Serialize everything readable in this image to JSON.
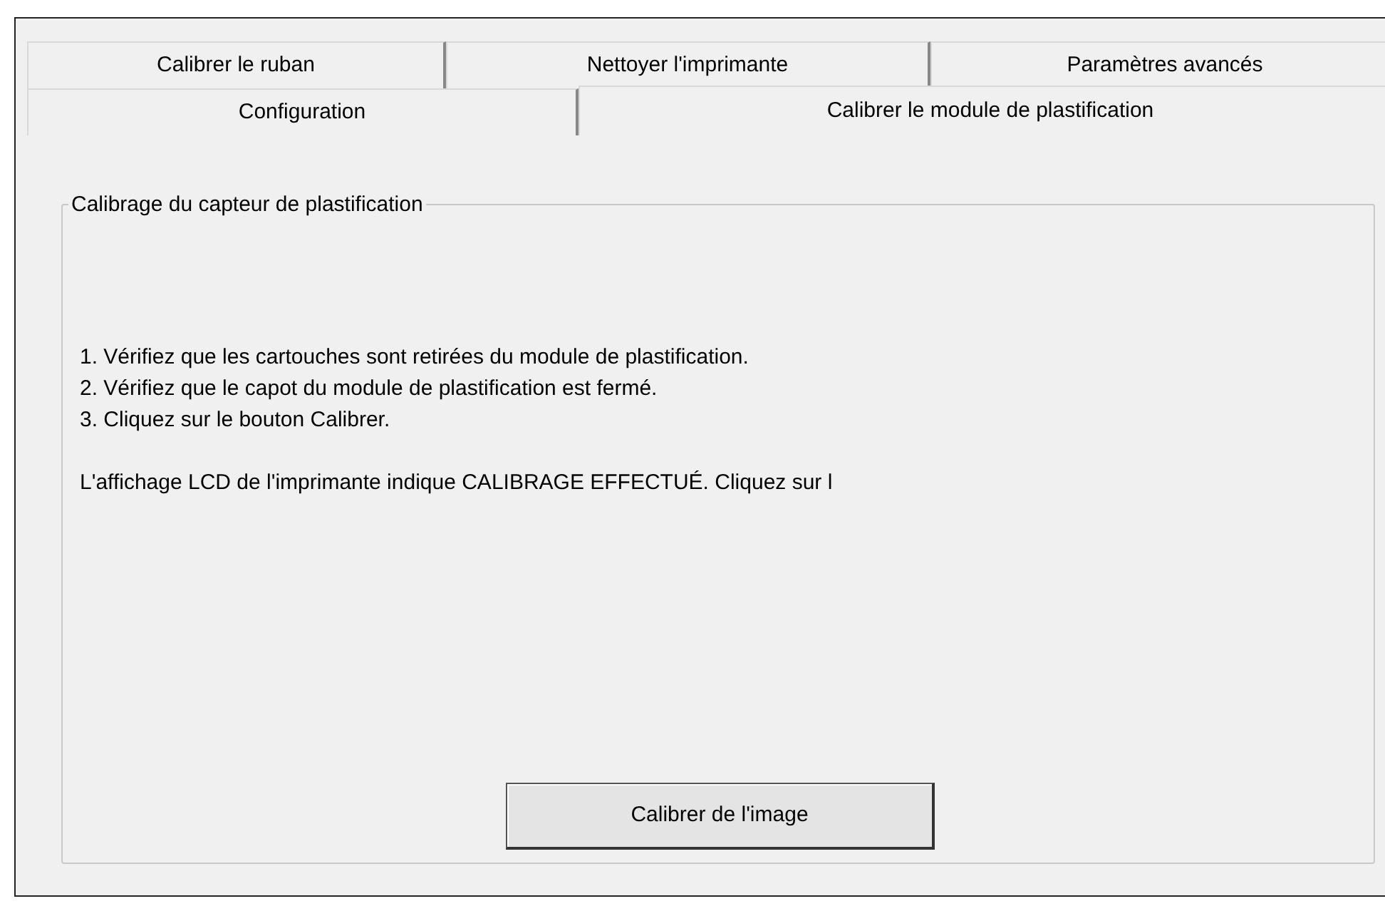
{
  "tab_rows": [
    [
      {
        "label": "Calibrer le ruban",
        "selected": false
      },
      {
        "label": "Nettoyer l'imprimante",
        "selected": false
      },
      {
        "label": "Paramètres avancés",
        "selected": false
      }
    ],
    [
      {
        "label": "Configuration",
        "selected": false
      },
      {
        "label": "Calibrer le module de plastification",
        "selected": true
      }
    ]
  ],
  "group": {
    "title": "Calibrage du capteur de plastification",
    "steps": [
      "1. Vérifiez que les cartouches sont retirées du module de plastification.",
      "2. Vérifiez que le capot du module de plastification est fermé.",
      "3. Cliquez sur le bouton Calibrer."
    ],
    "note": "L'affichage LCD de l'imprimante indique CALIBRAGE EFFECTUÉ. Cliquez sur l",
    "button": "Calibrer de l'image"
  }
}
